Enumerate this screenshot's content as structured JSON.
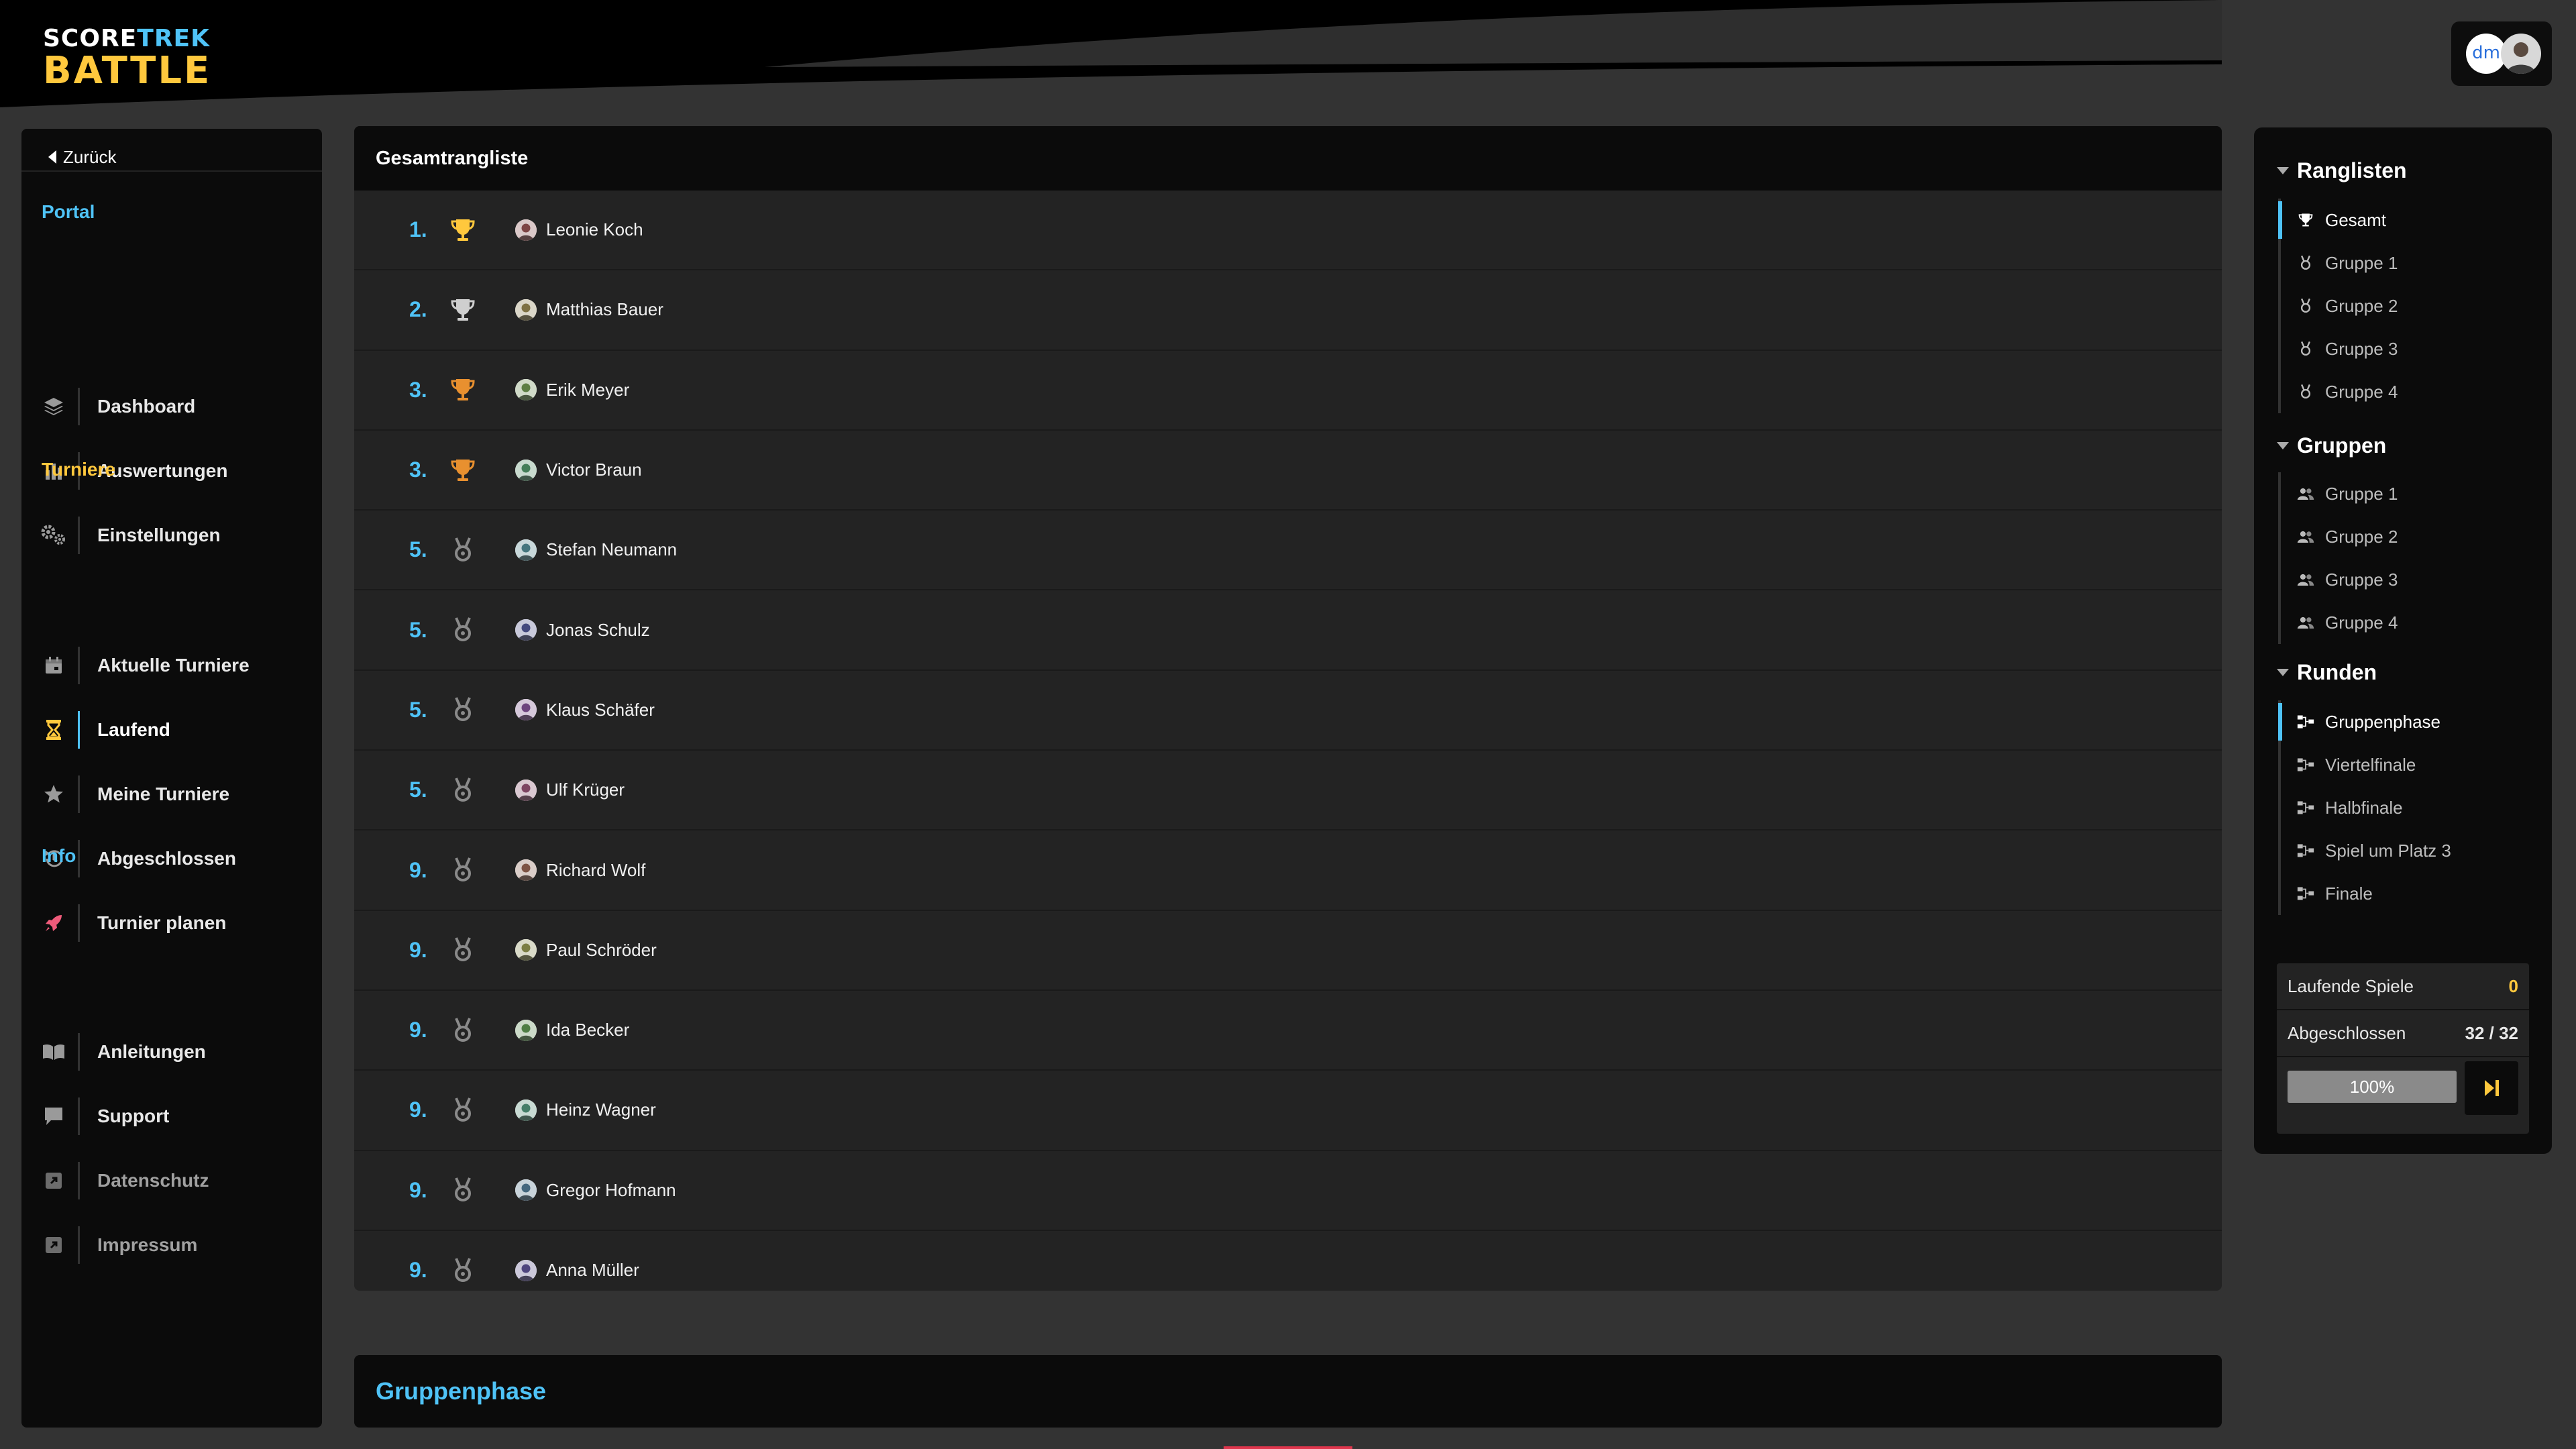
{
  "logo": {
    "score": "SCORE",
    "trek": "TREK",
    "battle": "BATTLE"
  },
  "user": {
    "initials": "dm"
  },
  "sidebar": {
    "back_label": "Zurück",
    "sections": {
      "portal": "Portal",
      "turniere": "Turniere",
      "info": "Info"
    },
    "items": [
      {
        "label": "Dashboard",
        "icon": "layers-icon"
      },
      {
        "label": "Auswertungen",
        "icon": "bar-chart-icon"
      },
      {
        "label": "Einstellungen",
        "icon": "gears-icon"
      },
      {
        "label": "Aktuelle Turniere",
        "icon": "calendar-icon"
      },
      {
        "label": "Laufend",
        "icon": "hourglass-icon",
        "active": true
      },
      {
        "label": "Meine Turniere",
        "icon": "star-icon"
      },
      {
        "label": "Abgeschlossen",
        "icon": "history-icon"
      },
      {
        "label": "Turnier planen",
        "icon": "rocket-icon"
      },
      {
        "label": "Anleitungen",
        "icon": "book-icon"
      },
      {
        "label": "Support",
        "icon": "chat-icon"
      },
      {
        "label": "Datenschutz",
        "icon": "external-link-icon"
      },
      {
        "label": "Impressum",
        "icon": "external-link-icon"
      }
    ]
  },
  "main": {
    "title": "Gesamtrangliste",
    "ranking": [
      {
        "pos": "1.",
        "name": "Leonie Koch",
        "award": "gold"
      },
      {
        "pos": "2.",
        "name": "Matthias Bauer",
        "award": "silver"
      },
      {
        "pos": "3.",
        "name": "Erik Meyer",
        "award": "bronze"
      },
      {
        "pos": "3.",
        "name": "Victor Braun",
        "award": "bronze"
      },
      {
        "pos": "5.",
        "name": "Stefan Neumann",
        "award": "medal"
      },
      {
        "pos": "5.",
        "name": "Jonas Schulz",
        "award": "medal"
      },
      {
        "pos": "5.",
        "name": "Klaus Schäfer",
        "award": "medal"
      },
      {
        "pos": "5.",
        "name": "Ulf Krüger",
        "award": "medal"
      },
      {
        "pos": "9.",
        "name": "Richard Wolf",
        "award": "medal"
      },
      {
        "pos": "9.",
        "name": "Paul Schröder",
        "award": "medal"
      },
      {
        "pos": "9.",
        "name": "Ida Becker",
        "award": "medal"
      },
      {
        "pos": "9.",
        "name": "Heinz Wagner",
        "award": "medal"
      },
      {
        "pos": "9.",
        "name": "Gregor Hofmann",
        "award": "medal"
      },
      {
        "pos": "9.",
        "name": "Anna Müller",
        "award": "medal"
      }
    ],
    "phase_title": "Gruppenphase"
  },
  "right": {
    "ranglisten": {
      "title": "Ranglisten",
      "items": [
        "Gesamt",
        "Gruppe 1",
        "Gruppe 2",
        "Gruppe 3",
        "Gruppe 4"
      ]
    },
    "gruppen": {
      "title": "Gruppen",
      "items": [
        "Gruppe 1",
        "Gruppe 2",
        "Gruppe 3",
        "Gruppe 4"
      ]
    },
    "runden": {
      "title": "Runden",
      "items": [
        "Gruppenphase",
        "Viertelfinale",
        "Halbfinale",
        "Spiel um Platz 3",
        "Finale"
      ]
    },
    "stats": {
      "running_label": "Laufende Spiele",
      "running_value": "0",
      "finished_label": "Abgeschlossen",
      "finished_value": "32 / 32",
      "progress_label": "100%",
      "progress": 1.0
    }
  },
  "colors": {
    "accent": "#4fc3f7",
    "gold": "#ffc83d",
    "bg": "#333333",
    "panel": "#0b0b0b"
  }
}
